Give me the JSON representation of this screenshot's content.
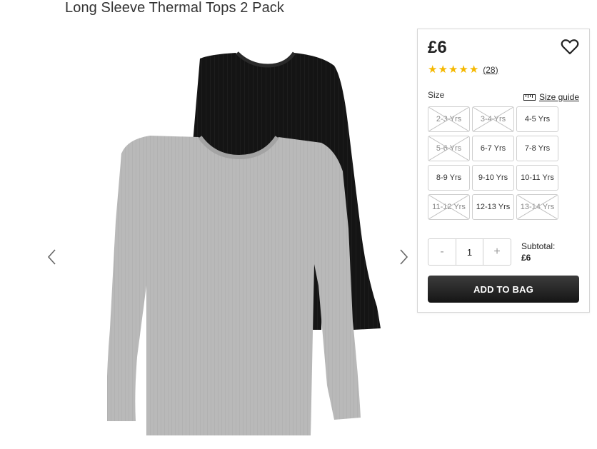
{
  "product": {
    "title": "Long Sleeve Thermal Tops 2 Pack",
    "price": "£6",
    "rating": 5,
    "review_count": "(28)"
  },
  "gallery": {
    "prev_icon": "chevron-left-icon",
    "next_icon": "chevron-right-icon",
    "colors": {
      "black_top": "#141414",
      "grey_top": "#b8b8b8"
    }
  },
  "sizes": {
    "label": "Size",
    "guide_label": "Size guide",
    "options": [
      {
        "label": "2-3 Yrs",
        "available": false
      },
      {
        "label": "3-4 Yrs",
        "available": false
      },
      {
        "label": "4-5 Yrs",
        "available": true
      },
      {
        "label": "5-6 Yrs",
        "available": false
      },
      {
        "label": "6-7 Yrs",
        "available": true
      },
      {
        "label": "7-8 Yrs",
        "available": true
      },
      {
        "label": "8-9 Yrs",
        "available": true
      },
      {
        "label": "9-10 Yrs",
        "available": true
      },
      {
        "label": "10-11 Yrs",
        "available": true
      },
      {
        "label": "11-12 Yrs",
        "available": false
      },
      {
        "label": "12-13 Yrs",
        "available": true
      },
      {
        "label": "13-14 Yrs",
        "available": false
      }
    ]
  },
  "quantity": {
    "minus": "-",
    "value": "1",
    "plus": "+"
  },
  "subtotal": {
    "label": "Subtotal:",
    "value": "£6"
  },
  "cta": {
    "add_to_bag": "ADD TO BAG"
  },
  "colors": {
    "star": "#f5b800",
    "button_dark": "#1c1c1c",
    "border": "#cfcfcf"
  }
}
